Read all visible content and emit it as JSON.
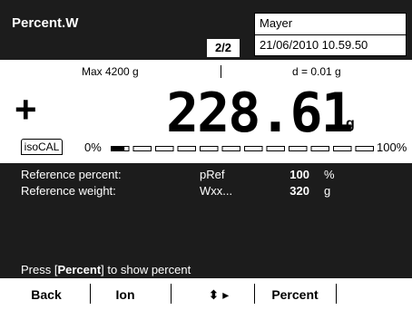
{
  "header": {
    "title": "Percent.W",
    "page_indicator": "2/2",
    "user": "Mayer",
    "datetime": "21/06/2010 10.59.50"
  },
  "balance": {
    "max_label": "Max 4200 g",
    "d_label": "d = 0.01 g",
    "sign": "+",
    "weight": "228.61",
    "unit": "g",
    "calibration_badge": "isoCAL",
    "range_min_label": "0%",
    "range_max_label": "100%",
    "capacity_fill": 0.054
  },
  "info": {
    "rows": [
      {
        "label": "Reference percent:",
        "symbol": "pRef",
        "value": "100",
        "unit": "%"
      },
      {
        "label": "Reference weight:",
        "symbol": "Wxx...",
        "value": "320",
        "unit": "g"
      }
    ],
    "hint_prefix": "Press ",
    "hint_bracket_open": "[",
    "hint_key": "Percent",
    "hint_bracket_close": "]",
    "hint_suffix": " to show percent"
  },
  "softkeys": {
    "back": "Back",
    "ion": "Ion",
    "nav": "⬍ ▸",
    "percent": "Percent"
  },
  "colors": {
    "panel_bg": "#1c1c1c",
    "foreground": "#000000"
  }
}
